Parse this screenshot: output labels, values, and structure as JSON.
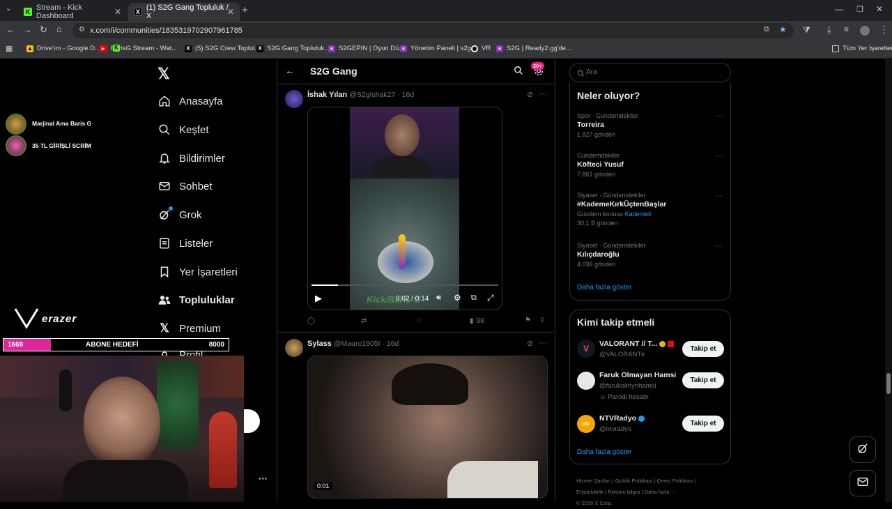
{
  "browser": {
    "tabs": [
      {
        "title": "Stream - Kick Dashboard"
      },
      {
        "title": "(1) S2G Gang Topluluk / X"
      }
    ],
    "new_tab": "+",
    "url": "x.com/i/communities/1835319702907961785",
    "bookmarks": [
      {
        "label": "Drive'ım - Google D..."
      },
      {
        "label": "BarisG Stream - Wat..."
      },
      {
        "label": "(5) S2G Crew Toplul..."
      },
      {
        "label": "S2G Gang Topluluk..."
      },
      {
        "label": "S2GEPIN | Oyun Dü..."
      },
      {
        "label": "Yönetim Paneli | s2g..."
      },
      {
        "label": "VR"
      },
      {
        "label": "S2G | Ready2.gg'de..."
      }
    ],
    "all_bookmarks": "Tüm Yer İşaretleri"
  },
  "overlay": {
    "alerts": [
      {
        "text": "Marjinal Ama Baris G"
      },
      {
        "text": "35 TL GİRİŞLİ SCRİM"
      }
    ],
    "brand": "erazer",
    "goal": {
      "current": "1669",
      "label": "ABONE HEDEFİ",
      "target": "8000",
      "fraction": 0.21
    }
  },
  "sidebar": {
    "items": [
      {
        "label": "Anasayfa",
        "icon": "home-icon"
      },
      {
        "label": "Keşfet",
        "icon": "search-icon"
      },
      {
        "label": "Bildirimler",
        "icon": "bell-icon"
      },
      {
        "label": "Sohbet",
        "icon": "mail-icon"
      },
      {
        "label": "Grok",
        "icon": "grok-icon"
      },
      {
        "label": "Listeler",
        "icon": "list-icon"
      },
      {
        "label": "Yer İşaretleri",
        "icon": "bookmark-icon"
      },
      {
        "label": "Topluluklar",
        "icon": "communities-icon"
      },
      {
        "label": "Premium",
        "icon": "x-logo-icon"
      },
      {
        "label": "Profil",
        "icon": "person-icon"
      }
    ]
  },
  "header": {
    "title": "S2G Gang",
    "badge": "20+"
  },
  "tweets": [
    {
      "name": "İshak Yılan",
      "handle": "@S2gIshak27",
      "time": "16d",
      "video": {
        "time": "0:02 / 0:14",
        "progress": 0.14,
        "watermark": "Kick/Baris G"
      },
      "views": "98"
    },
    {
      "name": "Sylass",
      "handle": "@Mauro1905I",
      "time": "16d",
      "video": {
        "time": "0:01"
      }
    }
  ],
  "search": {
    "placeholder": "Ara"
  },
  "trends": {
    "title": "Neler oluyor?",
    "items": [
      {
        "category": "Spor · Gündemdekiler",
        "name": "Torreira",
        "count": "1.827 gönderi",
        "extra": ""
      },
      {
        "category": "Gündemdekiler",
        "name": "Köfteci Yusuf",
        "count": "7.861 gönderi",
        "extra": ""
      },
      {
        "category": "Siyaset · Gündemdekiler",
        "name": "#KademeKırkÜçtenBaşlar",
        "count": "30,1 B gönderi",
        "extra_label": "Gündem konusu",
        "extra": "Kademeli"
      },
      {
        "category": "Siyaset · Gündemdekiler",
        "name": "Kılıçdaroğlu",
        "count": "4.036 gönderi",
        "extra": ""
      }
    ],
    "show_more": "Daha fazla göster"
  },
  "who_to_follow": {
    "title": "Kimi takip etmeli",
    "accounts": [
      {
        "name": "VALORANT // T...",
        "handle": "@VALORANTtr",
        "note": ""
      },
      {
        "name": "Faruk Olmayan Hamsi",
        "handle": "@farukolmynhamsi",
        "note": "Parodi hesabı"
      },
      {
        "name": "NTVRadyo",
        "handle": "@ntvradyo",
        "note": ""
      }
    ],
    "follow_label": "Takip et",
    "show_more": "Daha fazla göster"
  },
  "footer": {
    "links": [
      "Hizmet Şartları",
      "Gizlilik Politikası",
      "Çerez Politikası",
      "Erişilebilirlik",
      "Reklam bilgisi",
      "Daha fazla ···"
    ],
    "copyright": "© 2026 X Corp."
  },
  "colors": {
    "accent": "#1d9bf0",
    "goal_fill": "#e0249a",
    "badge": "#f91880"
  }
}
